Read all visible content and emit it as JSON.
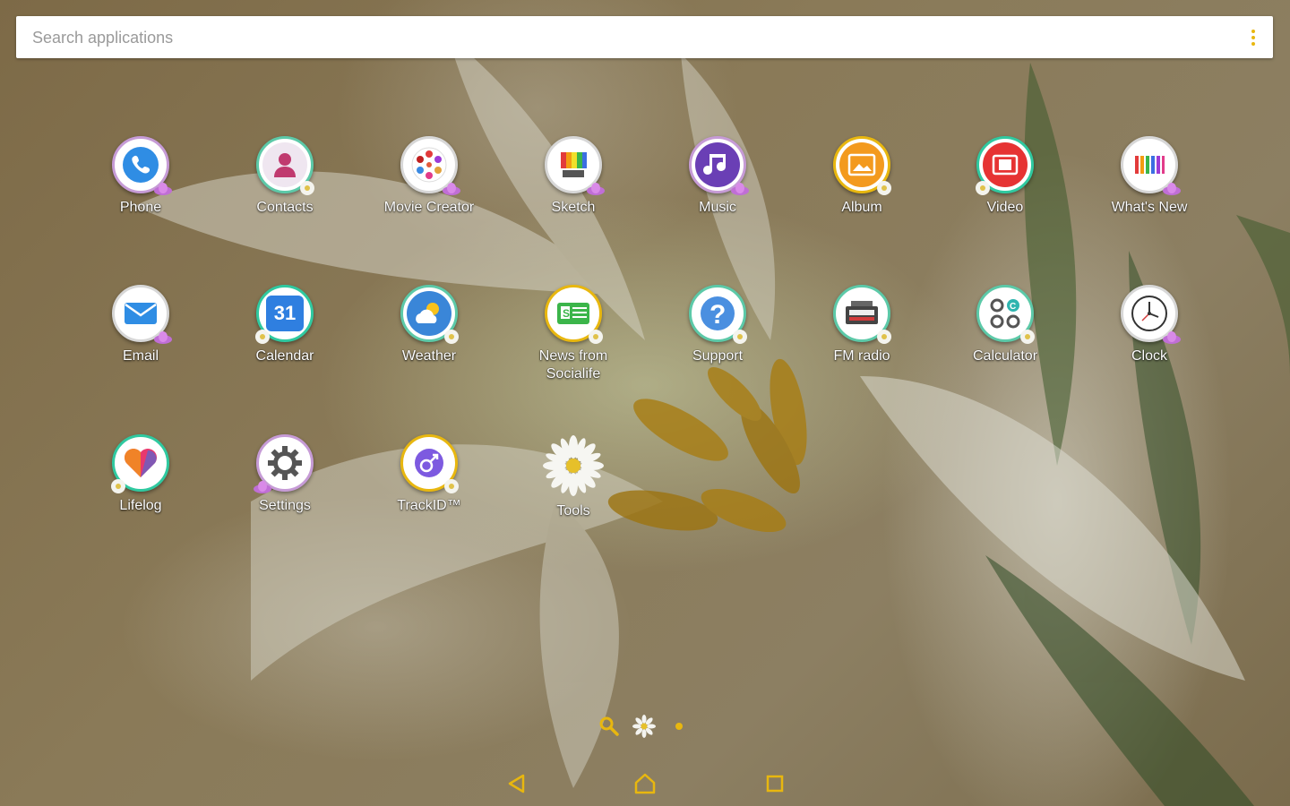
{
  "search": {
    "placeholder": "Search applications",
    "menu_icon": "overflow-menu-icon"
  },
  "accent_color": "#e8b70f",
  "apps": [
    {
      "label": "Phone",
      "icon": "phone-icon"
    },
    {
      "label": "Contacts",
      "icon": "contacts-icon"
    },
    {
      "label": "Movie Creator",
      "icon": "movie-creator-icon"
    },
    {
      "label": "Sketch",
      "icon": "sketch-icon"
    },
    {
      "label": "Music",
      "icon": "music-icon"
    },
    {
      "label": "Album",
      "icon": "album-icon"
    },
    {
      "label": "Video",
      "icon": "video-icon"
    },
    {
      "label": "What's New",
      "icon": "whats-new-icon"
    },
    {
      "label": "Email",
      "icon": "email-icon"
    },
    {
      "label": "Calendar",
      "icon": "calendar-icon",
      "day": "31"
    },
    {
      "label": "Weather",
      "icon": "weather-icon"
    },
    {
      "label": "News from\nSocialife",
      "icon": "news-icon"
    },
    {
      "label": "Support",
      "icon": "support-icon"
    },
    {
      "label": "FM radio",
      "icon": "radio-icon"
    },
    {
      "label": "Calculator",
      "icon": "calculator-icon"
    },
    {
      "label": "Clock",
      "icon": "clock-icon"
    },
    {
      "label": "Lifelog",
      "icon": "lifelog-icon"
    },
    {
      "label": "Settings",
      "icon": "settings-icon"
    },
    {
      "label": "TrackID™",
      "icon": "trackid-icon"
    },
    {
      "label": "Tools",
      "icon": "daisy-folder-icon"
    }
  ],
  "page_indicator": {
    "search": "search-icon",
    "home": "daisy-home-icon",
    "page": "page-dot-icon"
  },
  "navigation": {
    "back": "back-icon",
    "home": "home-icon",
    "recents": "recents-icon"
  }
}
